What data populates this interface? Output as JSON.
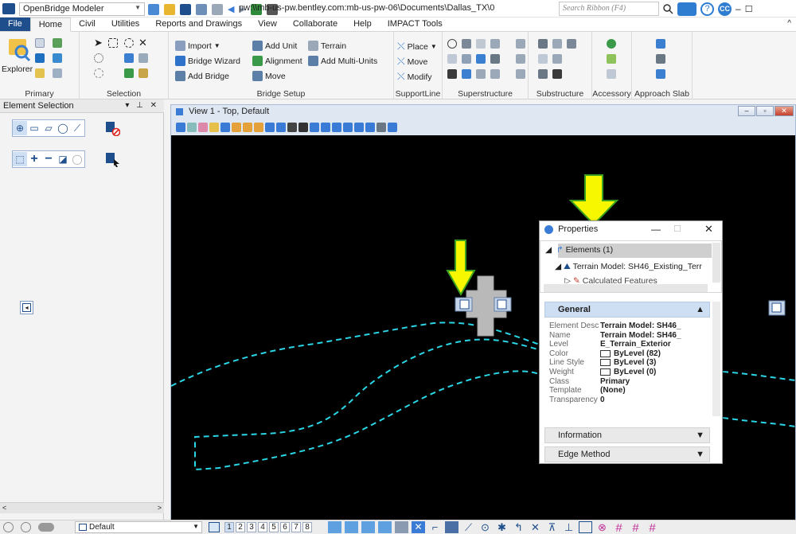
{
  "window": {
    "app_name": "OpenBridge Modeler",
    "doc_path": "pw:\\\\mb-us-pw.bentley.com:mb-us-pw-06\\Documents\\Dallas_TX\\0",
    "search_placeholder": "Search Ribbon (F4)",
    "user_initials": "CC"
  },
  "tabs": [
    "File",
    "Home",
    "Civil",
    "Utilities",
    "Reports and Drawings",
    "View",
    "Collaborate",
    "Help",
    "IMPACT Tools"
  ],
  "active_tab": "Home",
  "ribbon": {
    "primary": {
      "label": "Primary",
      "explorer": "Explorer"
    },
    "selection": {
      "label": "Selection"
    },
    "bridge_setup": {
      "label": "Bridge Setup",
      "import": "Import",
      "bridge_wizard": "Bridge Wizard",
      "add_bridge": "Add Bridge",
      "add_unit": "Add Unit",
      "alignment": "Alignment",
      "move": "Move",
      "terrain": "Terrain",
      "add_multi_units": "Add Multi-Units"
    },
    "support_line": {
      "label": "SupportLine",
      "place": "Place",
      "move": "Move",
      "modify": "Modify"
    },
    "superstructure": {
      "label": "Superstructure"
    },
    "substructure": {
      "label": "Substructure"
    },
    "accessory": {
      "label": "Accessory"
    },
    "approach_slab": {
      "label": "Approach Slab"
    }
  },
  "left_panel": {
    "title": "Element Selection"
  },
  "view": {
    "title": "View 1 - Top, Default"
  },
  "properties": {
    "title": "Properties",
    "tree": {
      "elements": "Elements (1)",
      "terrain_model": "Terrain Model: SH46_Existing_Terr",
      "calculated": "Calculated Features"
    },
    "general_label": "General",
    "fields": [
      {
        "label": "Element Desc",
        "value": "Terrain Model: SH46_"
      },
      {
        "label": "Name",
        "value": "Terrain Model: SH46_"
      },
      {
        "label": "Level",
        "value": "E_Terrain_Exterior"
      },
      {
        "label": "Color",
        "value": "ByLevel (82)"
      },
      {
        "label": "Line Style",
        "value": "ByLevel (3)"
      },
      {
        "label": "Weight",
        "value": "ByLevel (0)"
      },
      {
        "label": "Class",
        "value": "Primary"
      },
      {
        "label": "Template",
        "value": "(None)"
      },
      {
        "label": "Transparency",
        "value": "0"
      }
    ],
    "information_label": "Information",
    "edge_method_label": "Edge Method"
  },
  "status": {
    "view_set": "Default",
    "view_numbers": [
      "1",
      "2",
      "3",
      "4",
      "5",
      "6",
      "7",
      "8"
    ]
  },
  "colors": {
    "file_tab": "#1f4e8c",
    "terrain_line": "#2ad6e6",
    "annotation_arrow": "#f7f700",
    "arrow_outline": "#3aa020",
    "canvas_bg": "#000000"
  }
}
